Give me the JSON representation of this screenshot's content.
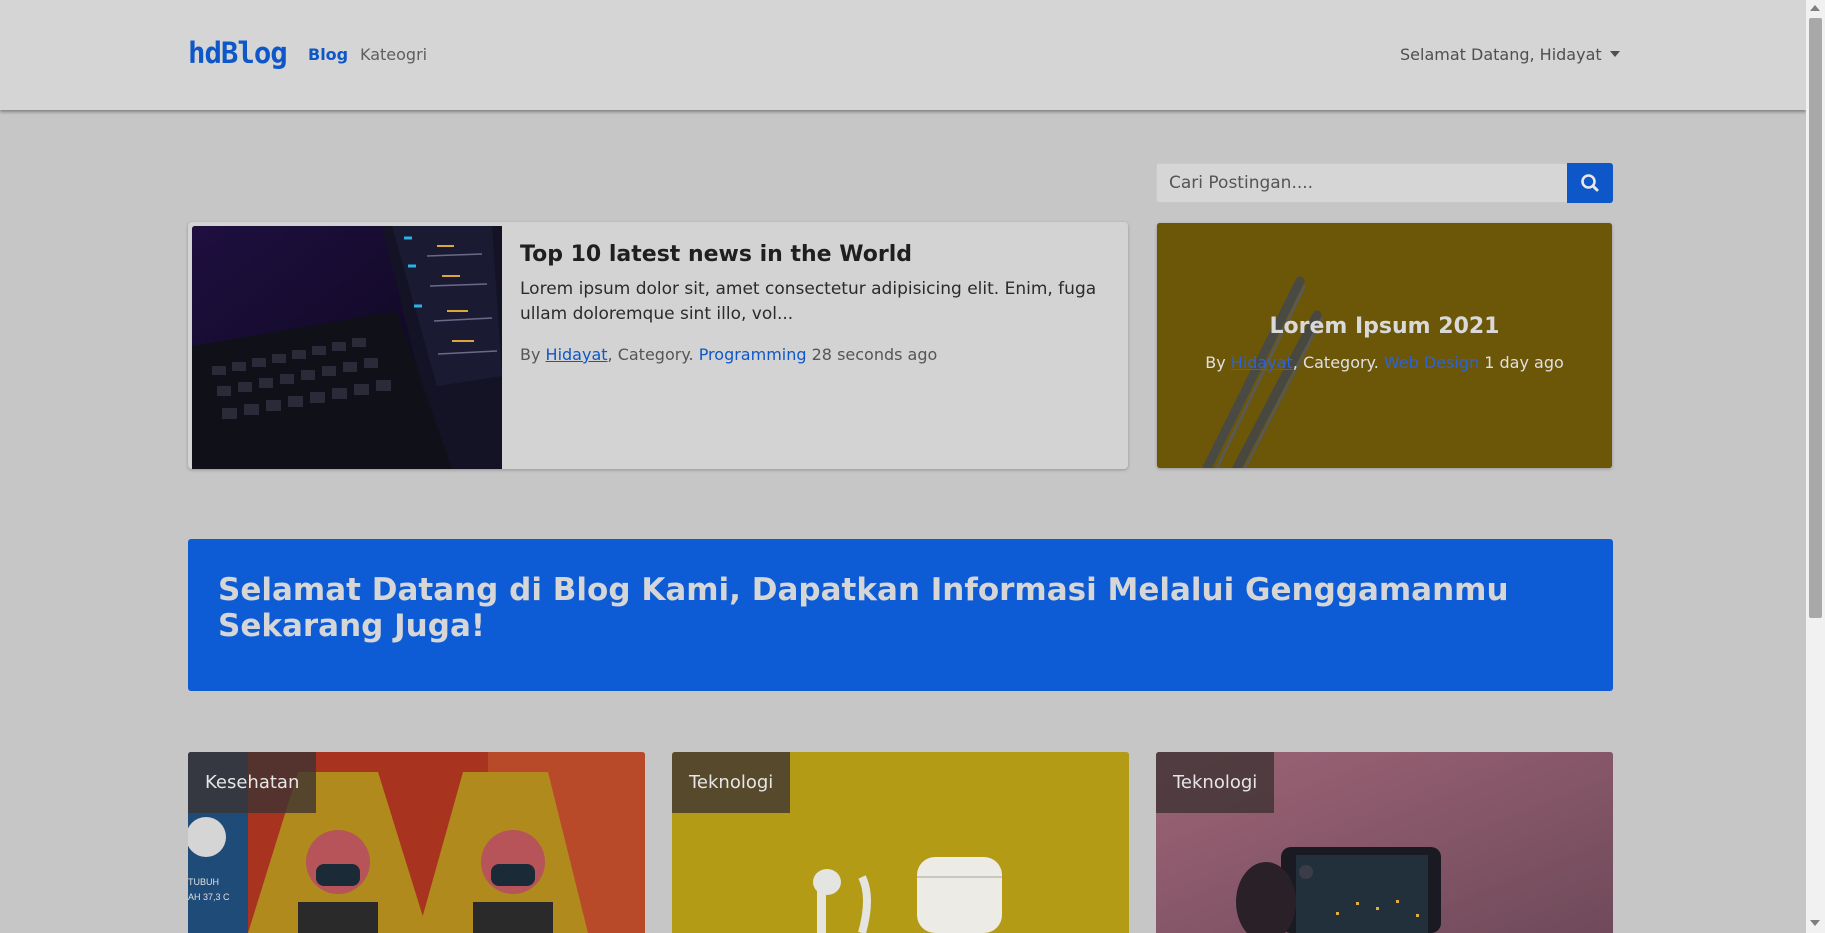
{
  "navbar": {
    "brand": "hdBlog",
    "links": [
      {
        "label": "Blog",
        "active": true
      },
      {
        "label": "Kateogri",
        "active": false
      }
    ],
    "user_menu": "Selamat Datang, Hidayat"
  },
  "search": {
    "placeholder": "Cari Postingan...."
  },
  "featured": {
    "title": "Top 10 latest news in the World",
    "excerpt": "Lorem ipsum dolor sit, amet consectetur adipisicing elit. Enim, fuga ullam doloremque sint illo, vol...",
    "by": "By",
    "author": "Hidayat",
    "category_prefix": ", Category.",
    "category": "Programming",
    "time": "28 seconds ago"
  },
  "side_card": {
    "title": "Lorem Ipsum 2021",
    "by": "By",
    "author": "Hidayat",
    "category_prefix": ", Category.",
    "category": "Web Design",
    "time": "1 day ago"
  },
  "banner": {
    "text": "Selamat Datang di Blog Kami, Dapatkan Informasi Melalui Genggamanmu Sekarang Juga!"
  },
  "posts": [
    {
      "category": "Kesehatan"
    },
    {
      "category": "Teknologi"
    },
    {
      "category": "Teknologi"
    }
  ],
  "colors": {
    "primary": "#0e57c9",
    "banner": "#0e5bd6",
    "page_bg": "#c6c6c6",
    "navbar_bg": "#d5d5d5"
  }
}
